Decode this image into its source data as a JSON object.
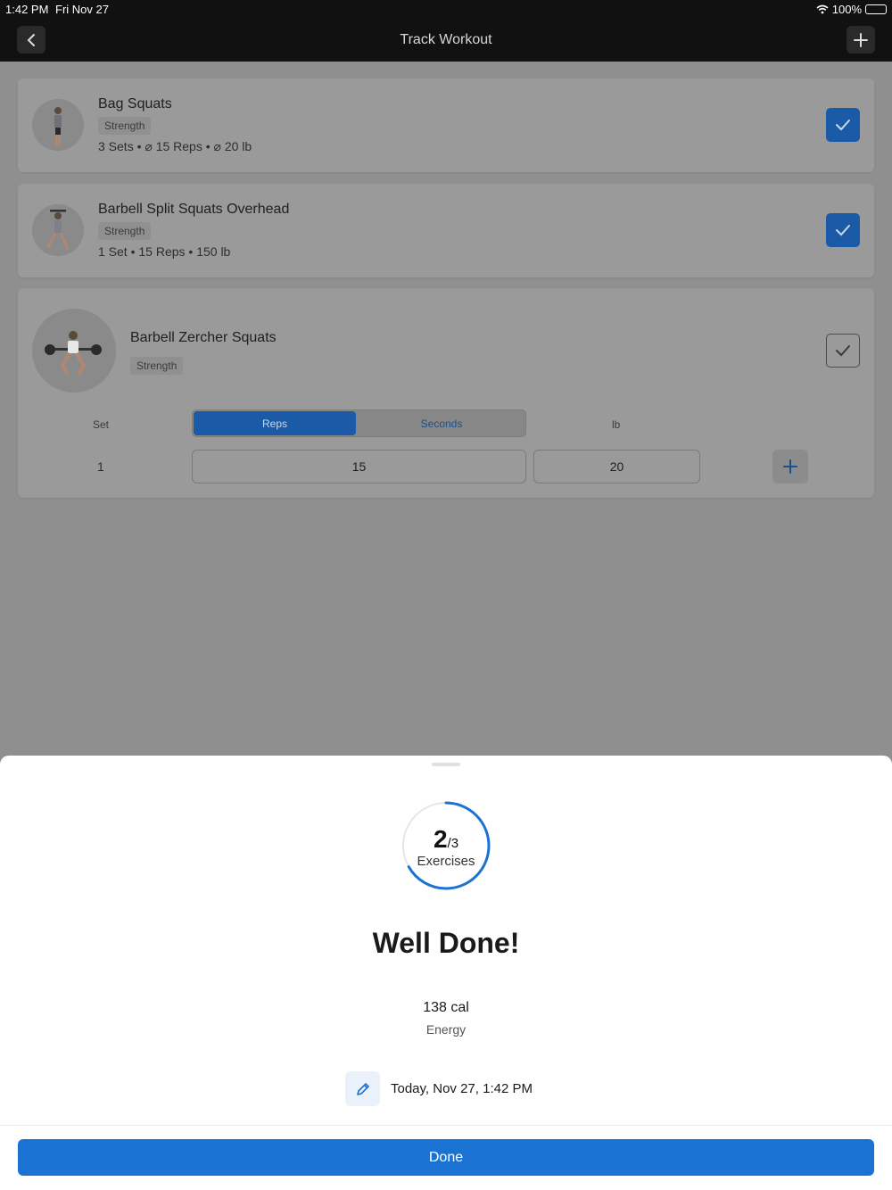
{
  "status_bar": {
    "time": "1:42 PM",
    "date": "Fri Nov 27",
    "battery": "100%"
  },
  "nav": {
    "title": "Track Workout",
    "back_icon": "chevron-left-icon",
    "add_icon": "plus-icon"
  },
  "exercises": [
    {
      "name": "Bag Squats",
      "tag": "Strength",
      "summary": "3 Sets • ⌀ 15 Reps • ⌀ 20 lb",
      "completed": true
    },
    {
      "name": "Barbell Split Squats Overhead",
      "tag": "Strength",
      "summary": "1 Set • 15 Reps • 150 lb",
      "completed": true
    },
    {
      "name": "Barbell Zercher Squats",
      "tag": "Strength",
      "completed": false,
      "columns": {
        "set": "Set",
        "reps": "Reps",
        "seconds": "Seconds",
        "unit": "lb"
      },
      "selected_mode": "Reps",
      "sets": [
        {
          "number": "1",
          "reps": "15",
          "weight": "20"
        }
      ]
    }
  ],
  "sheet": {
    "progress": {
      "done": "2",
      "total": "/3",
      "label": "Exercises",
      "fraction": 0.667
    },
    "headline": "Well Done!",
    "energy": {
      "value": "138 cal",
      "label": "Energy"
    },
    "date": "Today, Nov 27, 1:42 PM",
    "done_label": "Done"
  },
  "colors": {
    "accent": "#1a73d2",
    "check_bg": "#1a5aa6"
  }
}
